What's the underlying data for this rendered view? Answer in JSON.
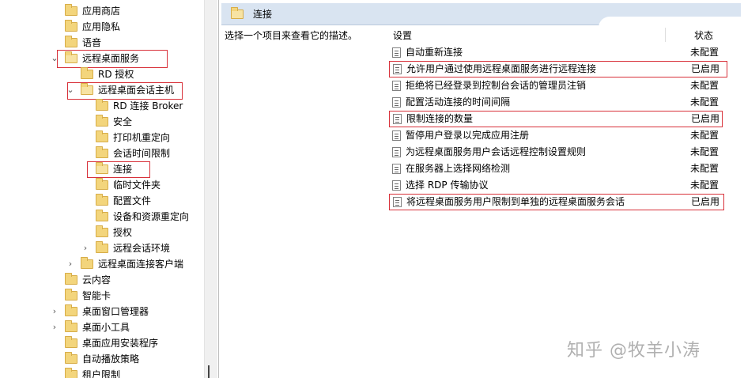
{
  "tree": {
    "items": [
      {
        "label": "应用商店",
        "expander": "",
        "highlight": false
      },
      {
        "label": "应用隐私",
        "expander": "",
        "highlight": false
      },
      {
        "label": "语音",
        "expander": "",
        "highlight": false
      },
      {
        "label": "远程桌面服务",
        "expander": "⌄",
        "highlight": true
      },
      {
        "label": "RD 授权",
        "expander": "",
        "highlight": false
      },
      {
        "label": "远程桌面会话主机",
        "expander": "⌄",
        "highlight": true
      },
      {
        "label": "RD 连接 Broker",
        "expander": "",
        "highlight": false
      },
      {
        "label": "安全",
        "expander": "",
        "highlight": false
      },
      {
        "label": "打印机重定向",
        "expander": "",
        "highlight": false
      },
      {
        "label": "会话时间限制",
        "expander": "",
        "highlight": false
      },
      {
        "label": "连接",
        "expander": "",
        "highlight": true
      },
      {
        "label": "临时文件夹",
        "expander": "",
        "highlight": false
      },
      {
        "label": "配置文件",
        "expander": "",
        "highlight": false
      },
      {
        "label": "设备和资源重定向",
        "expander": "",
        "highlight": false
      },
      {
        "label": "授权",
        "expander": "",
        "highlight": false
      },
      {
        "label": "远程会话环境",
        "expander": "›",
        "highlight": false
      },
      {
        "label": "远程桌面连接客户端",
        "expander": "›",
        "highlight": false
      },
      {
        "label": "云内容",
        "expander": "",
        "highlight": false
      },
      {
        "label": "智能卡",
        "expander": "",
        "highlight": false
      },
      {
        "label": "桌面窗口管理器",
        "expander": "›",
        "highlight": false
      },
      {
        "label": "桌面小工具",
        "expander": "›",
        "highlight": false
      },
      {
        "label": "桌面应用安装程序",
        "expander": "",
        "highlight": false
      },
      {
        "label": "自动播放策略",
        "expander": "",
        "highlight": false
      },
      {
        "label": "租户限制",
        "expander": "",
        "highlight": false
      }
    ]
  },
  "right": {
    "header_title": "连接",
    "description": "选择一个项目来查看它的描述。",
    "columns": {
      "setting": "设置",
      "state": "状态"
    },
    "rows": [
      {
        "name": "自动重新连接",
        "state": "未配置",
        "highlight": false
      },
      {
        "name": "允许用户通过使用远程桌面服务进行远程连接",
        "state": "已启用",
        "highlight": true
      },
      {
        "name": "拒绝将已经登录到控制台会话的管理员注销",
        "state": "未配置",
        "highlight": false
      },
      {
        "name": "配置活动连接的时间间隔",
        "state": "未配置",
        "highlight": false
      },
      {
        "name": "限制连接的数量",
        "state": "已启用",
        "highlight": true
      },
      {
        "name": "暂停用户登录以完成应用注册",
        "state": "未配置",
        "highlight": false
      },
      {
        "name": "为远程桌面服务用户会话远程控制设置规则",
        "state": "未配置",
        "highlight": false
      },
      {
        "name": "在服务器上选择网络检测",
        "state": "未配置",
        "highlight": false
      },
      {
        "name": "选择 RDP 传输协议",
        "state": "未配置",
        "highlight": false
      },
      {
        "name": "将远程桌面服务用户限制到单独的远程桌面服务会话",
        "state": "已启用",
        "highlight": true
      }
    ]
  },
  "watermark": "知乎 @牧羊小涛",
  "colors": {
    "highlight": "#d8313a",
    "header_bg": "#d9e4f1",
    "folder": "#f3d57c"
  }
}
